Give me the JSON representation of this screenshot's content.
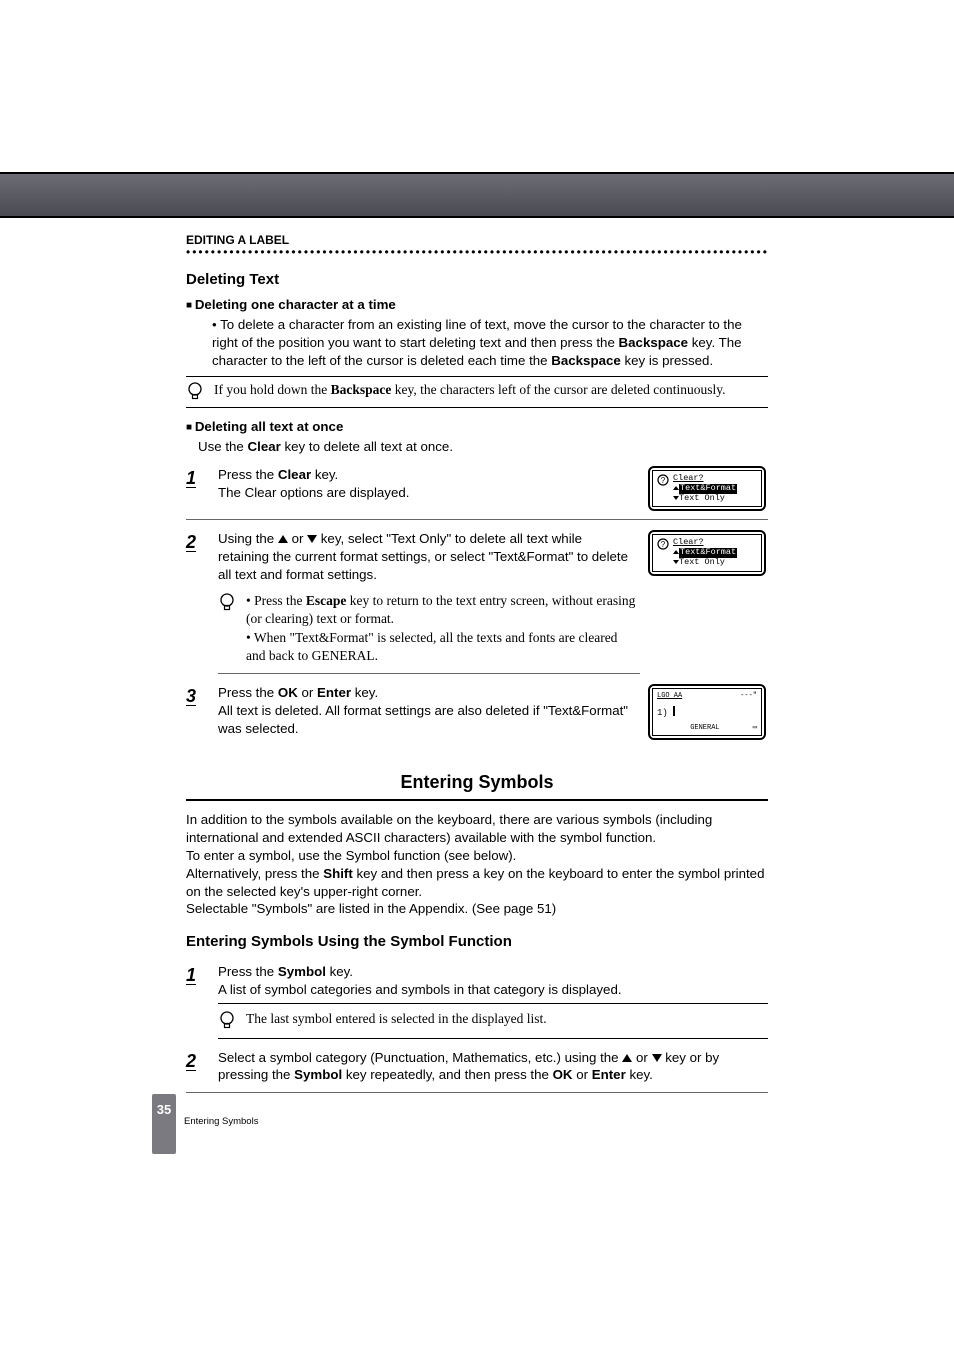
{
  "section_label": "EDITING A LABEL",
  "deleting": {
    "heading": "Deleting Text",
    "one_char": {
      "title": "Deleting one character at a time",
      "bullet_pre": "To delete a character from an existing line of text, move the cursor to the character to the right of the position you want to start deleting text and then press the ",
      "bullet_key": "Backspace",
      "bullet_mid": " key. The character to the left of the cursor is deleted each time the ",
      "bullet_key2": "Backspace",
      "bullet_post": " key is pressed.",
      "note_pre": "If you hold down the ",
      "note_key": "Backspace",
      "note_post": " key, the characters left of the cursor are deleted continuously."
    },
    "all_text": {
      "title": "Deleting all text at once",
      "line_pre": "Use the ",
      "line_key": "Clear",
      "line_post": " key to delete all text at once."
    },
    "step1": {
      "num": "1",
      "l1_pre": "Press the ",
      "l1_key": "Clear",
      "l1_post": " key.",
      "l2": "The Clear options are displayed.",
      "lcd_title": "Clear?",
      "lcd_opt1": "Text&Format",
      "lcd_opt2": "Text Only"
    },
    "step2": {
      "num": "2",
      "t_pre": "Using the ",
      "t_mid": " or ",
      "t_post1": " key, select \"Text Only\" to delete all text while retaining the current format settings, or select \"Text&Format\" to delete all text and format settings.",
      "note_a_pre": "Press the ",
      "note_a_key": "Escape",
      "note_a_post": " key to return to the text entry screen, without erasing (or clearing) text or format.",
      "note_b": "When \"Text&Format\" is selected, all the texts and fonts are cleared and back to GENERAL.",
      "lcd_title": "Clear?",
      "lcd_opt1": "Text&Format",
      "lcd_opt2": "Text Only"
    },
    "step3": {
      "num": "3",
      "l1_pre": "Press the ",
      "l1_k1": "OK",
      "l1_mid": " or ",
      "l1_k2": "Enter",
      "l1_post": " key.",
      "l2": "All text is deleted. All format settings are also deleted if \"Text&Format\" was selected.",
      "lcd_top": "LGO AA",
      "lcd_top_right": "---\"",
      "lcd_mid": "1)",
      "lcd_bl": "GENERAL"
    }
  },
  "symbols": {
    "heading": "Entering Symbols",
    "para1": "In addition to the symbols available on the keyboard, there are various symbols (including international and extended ASCII characters) available with the symbol function.",
    "para2": "To enter a symbol, use the Symbol function (see below).",
    "para3_pre": "Alternatively, press the ",
    "para3_key": "Shift",
    "para3_post": " key and then press a key on the keyboard to enter the symbol printed on the selected key's upper-right corner.",
    "para4": "Selectable \"Symbols\" are listed in the Appendix. (See page 51)",
    "sub_heading": "Entering Symbols Using the Symbol Function",
    "step1": {
      "num": "1",
      "l1_pre": "Press the ",
      "l1_key": "Symbol",
      "l1_post": " key.",
      "l2": "A list of symbol categories and symbols in that category is displayed.",
      "note": "The last symbol entered is selected in the displayed list."
    },
    "step2": {
      "num": "2",
      "t_pre": "Select a symbol category (Punctuation, Mathematics, etc.) using the ",
      "t_mid": " or ",
      "t_post_pre": " key or by pressing the ",
      "t_key": "Symbol",
      "t_post_mid": " key repeatedly, and then press the ",
      "t_k1": "OK",
      "t_or": " or ",
      "t_k2": "Enter",
      "t_end": " key."
    }
  },
  "page_number": "35",
  "footer_caption": "Entering Symbols"
}
